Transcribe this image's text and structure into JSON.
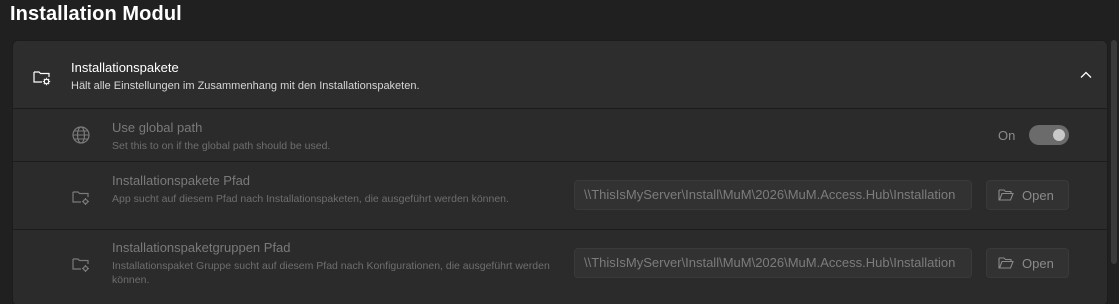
{
  "page": {
    "title": "Installation Modul"
  },
  "section": {
    "title": "Installationspakete",
    "description": "Hält alle Einstellungen im Zusammenhang mit den Installationspaketen.",
    "icon": "folder-settings-icon",
    "expanded_icon": "chevron-up-icon"
  },
  "settings": {
    "global_path": {
      "title": "Use global path",
      "description": "Set this to on if the global path should be used.",
      "icon": "globe-icon",
      "toggle_label": "On",
      "toggle_on": true
    },
    "paket_pfad": {
      "title": "Installationspakete Pfad",
      "description": "App sucht auf diesem Pfad nach Installationspaketen, die ausgeführt werden können.",
      "icon": "folder-settings-icon",
      "value": "\\\\ThisIsMyServer\\Install\\MuM\\2026\\MuM.Access.Hub\\Installation",
      "button_label": "Open",
      "button_icon": "folder-open-icon"
    },
    "gruppen_pfad": {
      "title": "Installationspaketgruppen Pfad",
      "description": "Installationspaket Gruppe sucht auf diesem Pfad nach Konfigurationen, die ausgeführt werden können.",
      "icon": "folder-settings-icon",
      "value": "\\\\ThisIsMyServer\\Install\\MuM\\2026\\MuM.Access.Hub\\Installation",
      "button_label": "Open",
      "button_icon": "folder-open-icon"
    }
  },
  "colors": {
    "background": "#202020",
    "card": "#2b2b2b",
    "disabled_text": "#7a7a7a"
  }
}
